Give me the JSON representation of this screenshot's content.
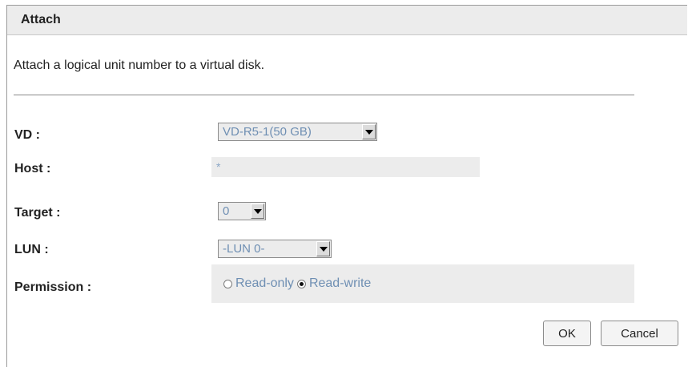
{
  "dialog": {
    "title": "Attach",
    "description": "Attach a logical unit number to a virtual disk."
  },
  "form": {
    "vd": {
      "label": "VD :",
      "value": "VD-R5-1(50 GB)"
    },
    "host": {
      "label": "Host :",
      "value": "*"
    },
    "target": {
      "label": "Target :",
      "value": "0"
    },
    "lun": {
      "label": "LUN :",
      "value": "-LUN 0-"
    },
    "permission": {
      "label": "Permission :",
      "options": [
        "Read-only",
        "Read-write"
      ],
      "selected": "Read-write"
    }
  },
  "buttons": {
    "ok": "OK",
    "cancel": "Cancel"
  },
  "colors": {
    "field_bg": "#ececec",
    "field_text": "#6f8fb3",
    "title_bg": "#ececec"
  }
}
